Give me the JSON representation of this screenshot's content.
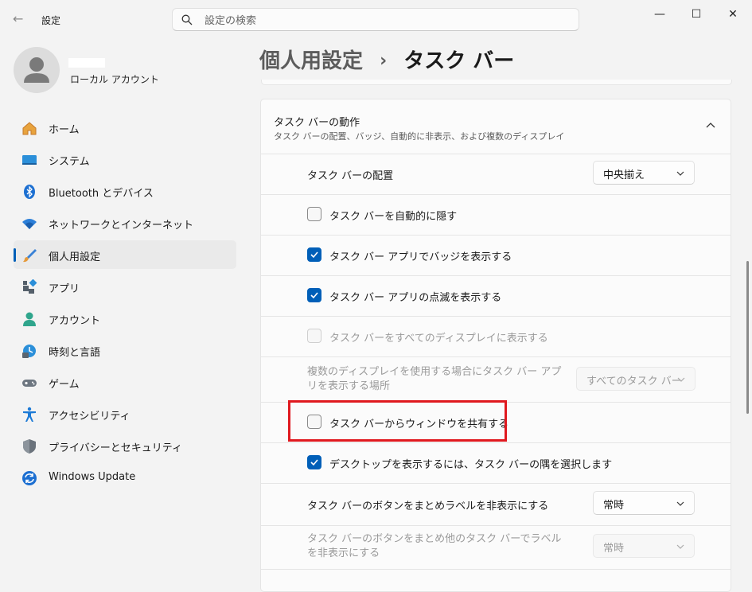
{
  "window": {
    "title": "設定",
    "controls": {
      "minimize": "—",
      "maximize": "☐",
      "close": "✕"
    }
  },
  "search": {
    "placeholder": "設定の検索"
  },
  "profile": {
    "account_type": "ローカル アカウント"
  },
  "sidebar": {
    "items": [
      {
        "label": "ホーム",
        "icon": "home-icon",
        "selected": false
      },
      {
        "label": "システム",
        "icon": "system-icon",
        "selected": false
      },
      {
        "label": "Bluetooth とデバイス",
        "icon": "bluetooth-icon",
        "selected": false
      },
      {
        "label": "ネットワークとインターネット",
        "icon": "wifi-icon",
        "selected": false
      },
      {
        "label": "個人用設定",
        "icon": "brush-icon",
        "selected": true
      },
      {
        "label": "アプリ",
        "icon": "apps-icon",
        "selected": false
      },
      {
        "label": "アカウント",
        "icon": "account-icon",
        "selected": false
      },
      {
        "label": "時刻と言語",
        "icon": "time-language-icon",
        "selected": false
      },
      {
        "label": "ゲーム",
        "icon": "gamepad-icon",
        "selected": false
      },
      {
        "label": "アクセシビリティ",
        "icon": "accessibility-icon",
        "selected": false
      },
      {
        "label": "プライバシーとセキュリティ",
        "icon": "shield-icon",
        "selected": false
      },
      {
        "label": "Windows Update",
        "icon": "windows-update-icon",
        "selected": false
      }
    ]
  },
  "breadcrumb": {
    "parent": "個人用設定",
    "separator": "›",
    "current": "タスク バー"
  },
  "group": {
    "title": "タスク バーの動作",
    "description": "タスク バーの配置、バッジ、自動的に非表示、および複数のディスプレイ",
    "rows": {
      "alignment": {
        "label": "タスク バーの配置",
        "value": "中央揃え"
      },
      "auto_hide": {
        "label": "タスク バーを自動的に隠す",
        "checked": false
      },
      "badges": {
        "label": "タスク バー アプリでバッジを表示する",
        "checked": true
      },
      "flashing": {
        "label": "タスク バー アプリの点滅を表示する",
        "checked": true
      },
      "all_displays": {
        "label": "タスク バーをすべてのディスプレイに表示する",
        "checked": false,
        "disabled": true
      },
      "multi_display": {
        "label": "複数のディスプレイを使用する場合にタスク バー アプリを表示する場所",
        "value": "すべてのタスク バー",
        "disabled": true
      },
      "share_window": {
        "label": "タスク バーからウィンドウを共有する",
        "checked": false
      },
      "far_corner": {
        "label": "デスクトップを表示するには、タスク バーの隅を選択します",
        "checked": true
      },
      "combine_main": {
        "label": "タスク バーのボタンをまとめラベルを非表示にする",
        "value": "常時"
      },
      "combine_other": {
        "label": "タスク バーのボタンをまとめ他のタスク バーでラベルを非表示にする",
        "value": "常時",
        "disabled": true
      }
    }
  },
  "colors": {
    "accent": "#005fb8",
    "highlight": "#e0191f",
    "background": "#f3f3f3",
    "card": "#fbfbfb"
  }
}
